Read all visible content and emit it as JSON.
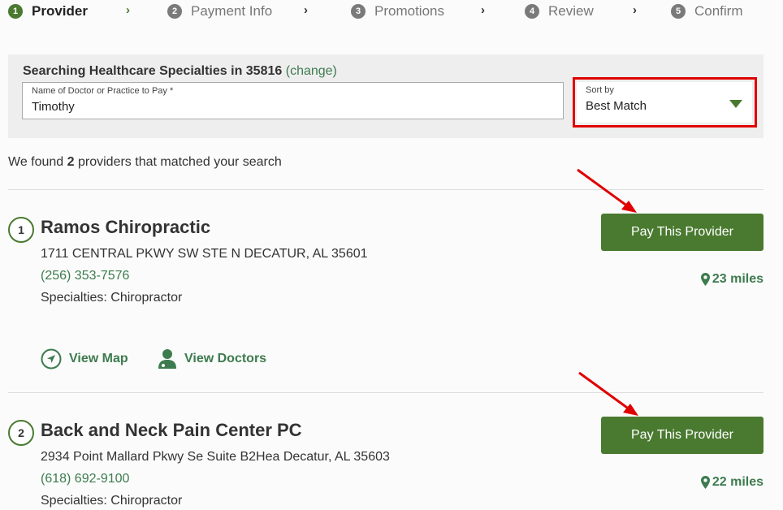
{
  "stepper": {
    "steps": [
      {
        "num": "1",
        "label": "Provider"
      },
      {
        "num": "2",
        "label": "Payment Info"
      },
      {
        "num": "3",
        "label": "Promotions"
      },
      {
        "num": "4",
        "label": "Review"
      },
      {
        "num": "5",
        "label": "Confirm"
      }
    ],
    "separator": "›"
  },
  "search": {
    "title": "Searching Healthcare Specialties in 35816",
    "change_link": "(change)",
    "name_label": "Name of Doctor or Practice to Pay *",
    "name_value": "Timothy",
    "sort_label": "Sort by",
    "sort_value": "Best Match"
  },
  "results": {
    "prefix": "We found ",
    "count": "2",
    "suffix": " providers that matched your search"
  },
  "providers": [
    {
      "index": "1",
      "name": "Ramos Chiropractic",
      "address": "1711 CENTRAL PKWY SW STE N DECATUR, AL 35601",
      "phone": "(256) 353-7576",
      "specialties": "Specialties: Chiropractor",
      "pay_label": "Pay This Provider",
      "distance": "23 miles",
      "view_map": "View Map",
      "view_doctors": "View Doctors"
    },
    {
      "index": "2",
      "name": "Back and Neck Pain Center PC",
      "address": "2934 Point Mallard Pkwy Se Suite B2Hea Decatur, AL 35603",
      "phone": "(618) 692-9100",
      "specialties": "Specialties: Chiropractor",
      "pay_label": "Pay This Provider",
      "distance": "22 miles"
    }
  ],
  "colors": {
    "brand_green": "#4a7a30",
    "link_green": "#3d7b4f",
    "highlight_red": "#e00000"
  }
}
